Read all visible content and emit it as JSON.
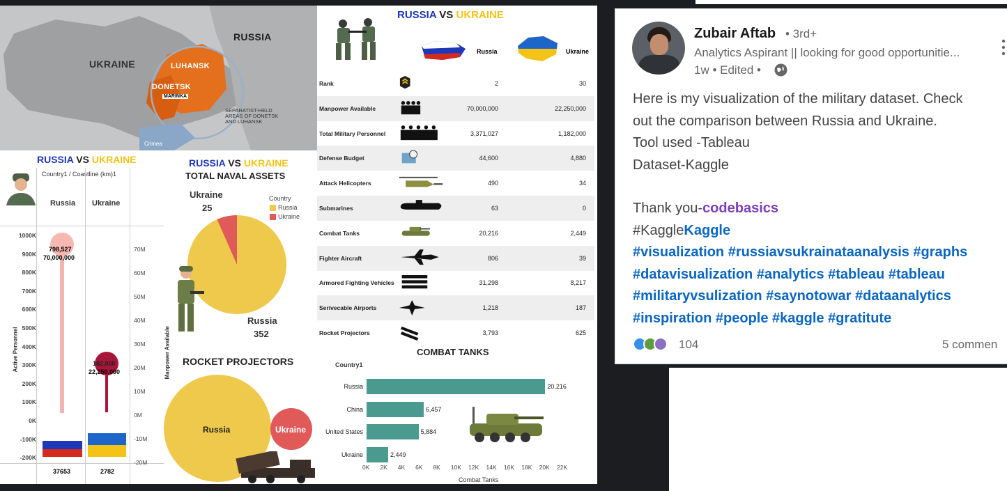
{
  "map": {
    "ukraine": "UKRAINE",
    "russia": "RUSSIA",
    "luhansk": "LUHANSK",
    "donetsk": "DONETSK",
    "marinka": "MARINKA",
    "separatist": "SEPARATIST-HELD",
    "separatist2": "AREAS OF DONETSK",
    "separatist3": "AND LUHANSK",
    "crimea": "Crimea"
  },
  "comparison": {
    "title_ru": "RUSSIA",
    "title_vs": " VS ",
    "title_ua": "UKRAINE",
    "col_ru": "Russia",
    "col_ua": "Ukraine",
    "rows": [
      {
        "label": "Rank",
        "ru": "2",
        "ua": "30",
        "icon": "rank-badge-icon"
      },
      {
        "label": "Manpower Available",
        "ru": "70,000,000",
        "ua": "22,250,000",
        "icon": "people-icon"
      },
      {
        "label": "Total Military Personnel",
        "ru": "3,371,027",
        "ua": "1,182,000",
        "icon": "soldiers-icon"
      },
      {
        "label": "Defense Budget",
        "ru": "44,600",
        "ua": "4,880",
        "icon": "money-icon"
      },
      {
        "label": "Attack Helicopters",
        "ru": "490",
        "ua": "34",
        "icon": "helicopter-icon"
      },
      {
        "label": "Submarines",
        "ru": "63",
        "ua": "0",
        "icon": "submarine-icon"
      },
      {
        "label": "Combat Tanks",
        "ru": "20,216",
        "ua": "2,449",
        "icon": "tank-icon"
      },
      {
        "label": "Fighter Aircraft",
        "ru": "806",
        "ua": "39",
        "icon": "jet-icon"
      },
      {
        "label": "Armored Fighting Vehicles",
        "ru": "31,298",
        "ua": "8,217",
        "icon": "armored-vehicle-icon"
      },
      {
        "label": "Serivecable Airports",
        "ru": "1,218",
        "ua": "187",
        "icon": "airport-icon"
      },
      {
        "label": "Rocket Projectors",
        "ru": "3,793",
        "ua": "625",
        "icon": "rocket-launcher-icon"
      }
    ]
  },
  "personnel": {
    "title_ru": "RUSSIA",
    "title_vs": " VS ",
    "title_ua": "UKRAINE",
    "header": "Country1 / Coastline (km)1",
    "col_ru": "Russia",
    "col_ua": "Ukraine",
    "left_axis_label": "Active Personnel",
    "right_axis_label": "Manpower Available",
    "left_ticks": [
      "1000K",
      "900K",
      "800K",
      "700K",
      "600K",
      "500K",
      "400K",
      "300K",
      "200K",
      "100K",
      "0K",
      "-100K",
      "-200K"
    ],
    "right_ticks": [
      "70M",
      "60M",
      "50M",
      "40M",
      "30M",
      "20M",
      "10M",
      "0M",
      "-10M",
      "-20M"
    ],
    "ru_active": "798,527",
    "ru_manpower": "70,000,000",
    "ua_active": "182,000",
    "ua_manpower": "22,250,000",
    "ru_coast": "37653",
    "ua_coast": "2782"
  },
  "naval": {
    "title_ru": "RUSSIA",
    "title_vs": " VS ",
    "title_ua": "UKRAINE",
    "subtitle": "TOTAL NAVAL ASSETS",
    "legend_title": "Country",
    "legend_ru": "Russia",
    "legend_ua": "Ukraine",
    "ua_label": "Ukraine",
    "ua_value": "25",
    "ru_label": "Russia",
    "ru_value": "352",
    "color_ru": "#efc94c",
    "color_ua": "#e05a5a"
  },
  "rockets": {
    "title": "ROCKET PROJECTORS",
    "ru": "Russia",
    "ua": "Ukraine"
  },
  "chart_data": {
    "type": "bar",
    "title": "COMBAT TANKS",
    "ylabel": "Country1",
    "xlabel": "Combat Tanks",
    "categories": [
      "Russia",
      "China",
      "United States",
      "Ukraine"
    ],
    "values": [
      20216,
      6457,
      5884,
      2449
    ],
    "value_labels": [
      "20,216",
      "6,457",
      "5,884",
      "2,449"
    ],
    "xlim": [
      0,
      22000
    ],
    "xticks": [
      "0K",
      "2K",
      "4K",
      "6K",
      "8K",
      "10K",
      "12K",
      "14K",
      "16K",
      "18K",
      "20K",
      "22K"
    ],
    "color": "#4a9a8f"
  },
  "post": {
    "author": "Zubair Aftab",
    "degree": "• 3rd+",
    "headline": "Analytics Aspirant || looking for good opportunitie...",
    "time": "1w • Edited •",
    "lines": [
      "Here is my visualization of the military dataset. Check",
      "out the comparison between Russia and Ukraine.",
      "Tool used -Tableau",
      "Dataset-Kaggle"
    ],
    "thanks": "Thank you-",
    "mention": "codebasics",
    "kaggle_prefix": "#Kaggle",
    "kaggle_link": "Kaggle",
    "hashtags1": "#visualization #russiavsukrainataanalysis #graphs",
    "hashtags2": "#datavisualization #analytics #tableau #tableau",
    "hashtags3": "#militaryvsulization #saynotowar #dataanalytics",
    "hashtags4": "#inspiration #people #kaggle #gratitute",
    "reactions": "104",
    "comments": "5 commen"
  }
}
